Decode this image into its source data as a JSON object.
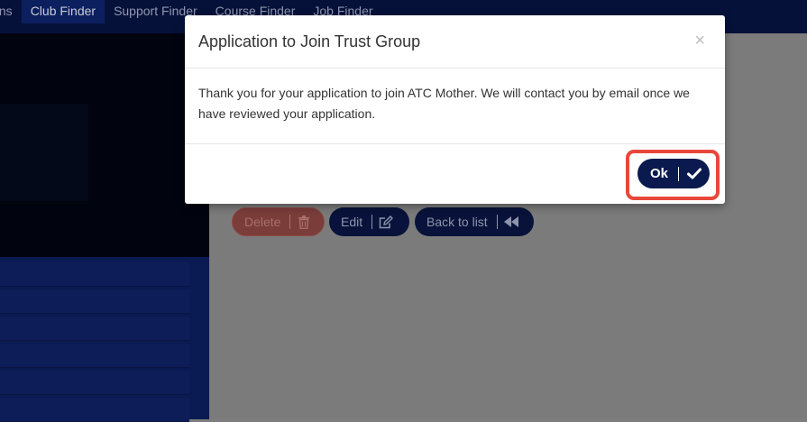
{
  "nav": {
    "items": [
      "ions",
      "Club Finder",
      "Support Finder",
      "Course Finder",
      "Job Finder"
    ],
    "active_index": 1
  },
  "actions": {
    "delete_label": "Delete",
    "edit_label": "Edit",
    "back_label": "Back to list"
  },
  "modal": {
    "title": "Application to Join Trust Group",
    "close_glyph": "×",
    "message": "Thank you for your application to join ATC Mother. We will contact you by email once we have reviewed your application.",
    "ok_label": "Ok"
  },
  "colors": {
    "nav_bg": "#06113a",
    "primary_button": "#0a1a4e",
    "delete_button": "#d9534f",
    "highlight": "#e8483b"
  },
  "icons": {
    "delete": "trash-icon",
    "edit": "edit-icon",
    "back": "rewind-icon",
    "ok": "checkmark-icon",
    "close": "close-icon"
  }
}
